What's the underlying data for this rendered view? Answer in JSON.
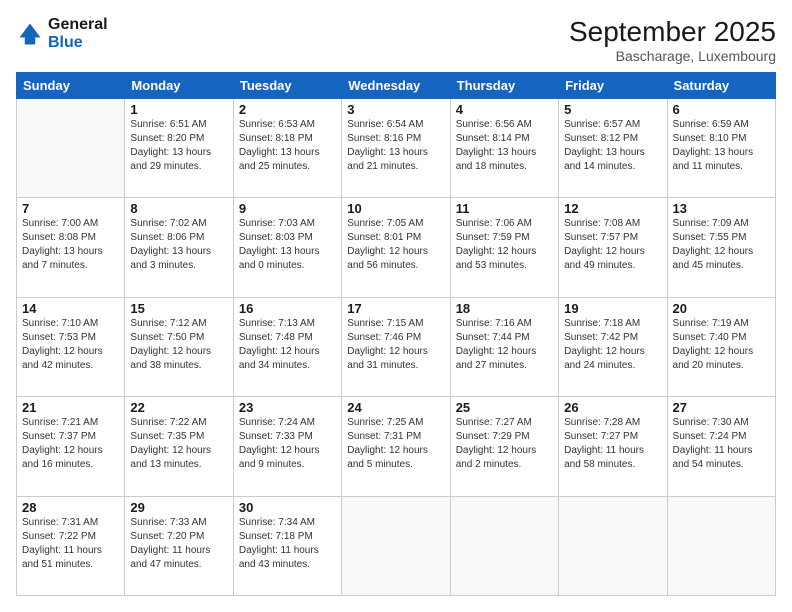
{
  "header": {
    "logo_line1": "General",
    "logo_line2": "Blue",
    "month_title": "September 2025",
    "location": "Bascharage, Luxembourg"
  },
  "weekdays": [
    "Sunday",
    "Monday",
    "Tuesday",
    "Wednesday",
    "Thursday",
    "Friday",
    "Saturday"
  ],
  "weeks": [
    [
      {
        "day": "",
        "info": ""
      },
      {
        "day": "1",
        "info": "Sunrise: 6:51 AM\nSunset: 8:20 PM\nDaylight: 13 hours\nand 29 minutes."
      },
      {
        "day": "2",
        "info": "Sunrise: 6:53 AM\nSunset: 8:18 PM\nDaylight: 13 hours\nand 25 minutes."
      },
      {
        "day": "3",
        "info": "Sunrise: 6:54 AM\nSunset: 8:16 PM\nDaylight: 13 hours\nand 21 minutes."
      },
      {
        "day": "4",
        "info": "Sunrise: 6:56 AM\nSunset: 8:14 PM\nDaylight: 13 hours\nand 18 minutes."
      },
      {
        "day": "5",
        "info": "Sunrise: 6:57 AM\nSunset: 8:12 PM\nDaylight: 13 hours\nand 14 minutes."
      },
      {
        "day": "6",
        "info": "Sunrise: 6:59 AM\nSunset: 8:10 PM\nDaylight: 13 hours\nand 11 minutes."
      }
    ],
    [
      {
        "day": "7",
        "info": "Sunrise: 7:00 AM\nSunset: 8:08 PM\nDaylight: 13 hours\nand 7 minutes."
      },
      {
        "day": "8",
        "info": "Sunrise: 7:02 AM\nSunset: 8:06 PM\nDaylight: 13 hours\nand 3 minutes."
      },
      {
        "day": "9",
        "info": "Sunrise: 7:03 AM\nSunset: 8:03 PM\nDaylight: 13 hours\nand 0 minutes."
      },
      {
        "day": "10",
        "info": "Sunrise: 7:05 AM\nSunset: 8:01 PM\nDaylight: 12 hours\nand 56 minutes."
      },
      {
        "day": "11",
        "info": "Sunrise: 7:06 AM\nSunset: 7:59 PM\nDaylight: 12 hours\nand 53 minutes."
      },
      {
        "day": "12",
        "info": "Sunrise: 7:08 AM\nSunset: 7:57 PM\nDaylight: 12 hours\nand 49 minutes."
      },
      {
        "day": "13",
        "info": "Sunrise: 7:09 AM\nSunset: 7:55 PM\nDaylight: 12 hours\nand 45 minutes."
      }
    ],
    [
      {
        "day": "14",
        "info": "Sunrise: 7:10 AM\nSunset: 7:53 PM\nDaylight: 12 hours\nand 42 minutes."
      },
      {
        "day": "15",
        "info": "Sunrise: 7:12 AM\nSunset: 7:50 PM\nDaylight: 12 hours\nand 38 minutes."
      },
      {
        "day": "16",
        "info": "Sunrise: 7:13 AM\nSunset: 7:48 PM\nDaylight: 12 hours\nand 34 minutes."
      },
      {
        "day": "17",
        "info": "Sunrise: 7:15 AM\nSunset: 7:46 PM\nDaylight: 12 hours\nand 31 minutes."
      },
      {
        "day": "18",
        "info": "Sunrise: 7:16 AM\nSunset: 7:44 PM\nDaylight: 12 hours\nand 27 minutes."
      },
      {
        "day": "19",
        "info": "Sunrise: 7:18 AM\nSunset: 7:42 PM\nDaylight: 12 hours\nand 24 minutes."
      },
      {
        "day": "20",
        "info": "Sunrise: 7:19 AM\nSunset: 7:40 PM\nDaylight: 12 hours\nand 20 minutes."
      }
    ],
    [
      {
        "day": "21",
        "info": "Sunrise: 7:21 AM\nSunset: 7:37 PM\nDaylight: 12 hours\nand 16 minutes."
      },
      {
        "day": "22",
        "info": "Sunrise: 7:22 AM\nSunset: 7:35 PM\nDaylight: 12 hours\nand 13 minutes."
      },
      {
        "day": "23",
        "info": "Sunrise: 7:24 AM\nSunset: 7:33 PM\nDaylight: 12 hours\nand 9 minutes."
      },
      {
        "day": "24",
        "info": "Sunrise: 7:25 AM\nSunset: 7:31 PM\nDaylight: 12 hours\nand 5 minutes."
      },
      {
        "day": "25",
        "info": "Sunrise: 7:27 AM\nSunset: 7:29 PM\nDaylight: 12 hours\nand 2 minutes."
      },
      {
        "day": "26",
        "info": "Sunrise: 7:28 AM\nSunset: 7:27 PM\nDaylight: 11 hours\nand 58 minutes."
      },
      {
        "day": "27",
        "info": "Sunrise: 7:30 AM\nSunset: 7:24 PM\nDaylight: 11 hours\nand 54 minutes."
      }
    ],
    [
      {
        "day": "28",
        "info": "Sunrise: 7:31 AM\nSunset: 7:22 PM\nDaylight: 11 hours\nand 51 minutes."
      },
      {
        "day": "29",
        "info": "Sunrise: 7:33 AM\nSunset: 7:20 PM\nDaylight: 11 hours\nand 47 minutes."
      },
      {
        "day": "30",
        "info": "Sunrise: 7:34 AM\nSunset: 7:18 PM\nDaylight: 11 hours\nand 43 minutes."
      },
      {
        "day": "",
        "info": ""
      },
      {
        "day": "",
        "info": ""
      },
      {
        "day": "",
        "info": ""
      },
      {
        "day": "",
        "info": ""
      }
    ]
  ]
}
